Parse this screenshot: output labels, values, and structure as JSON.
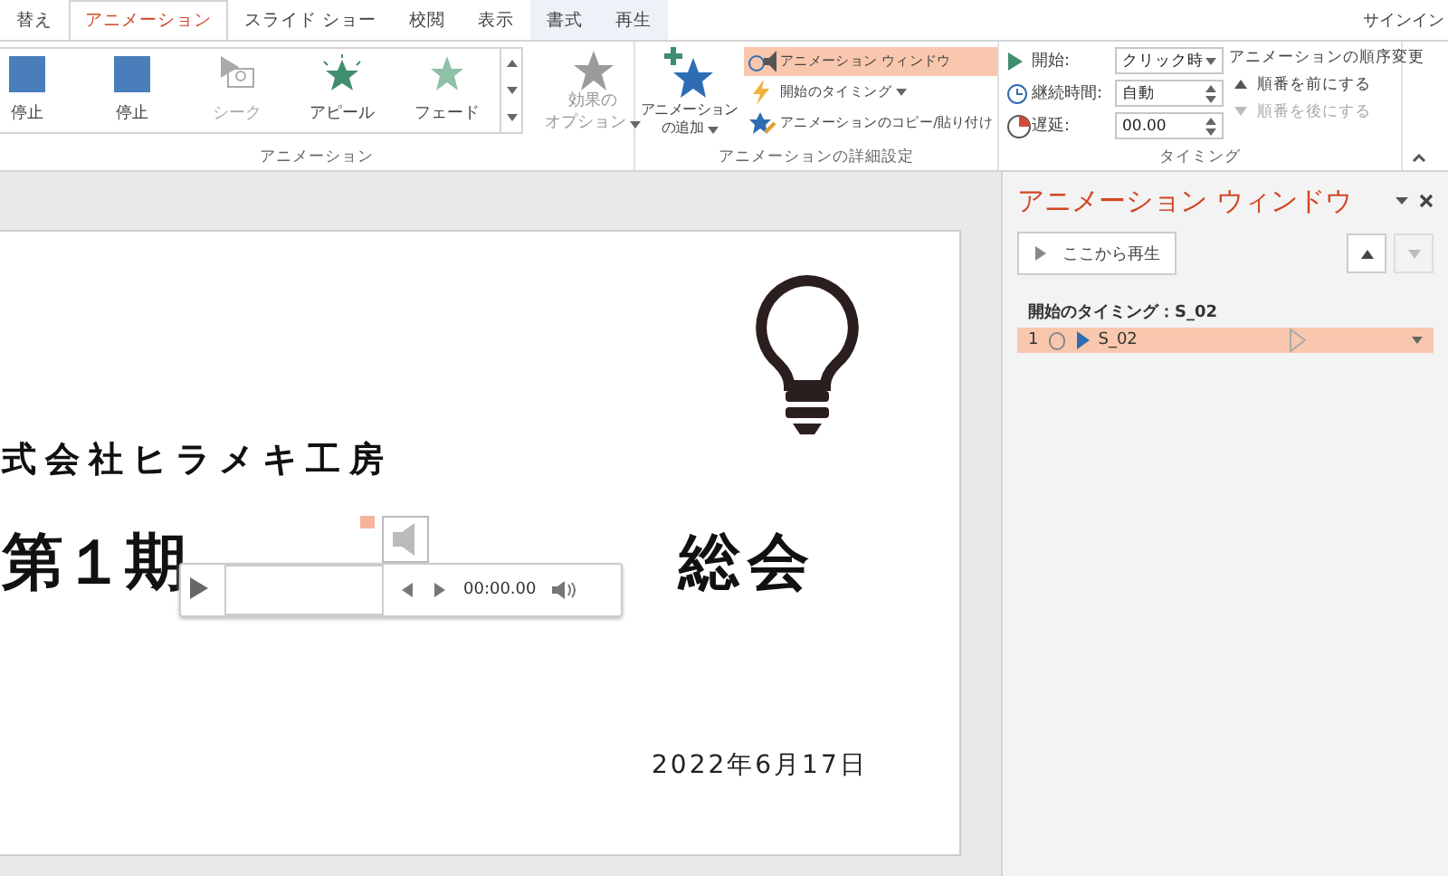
{
  "tabs": [
    {
      "label": "替え",
      "selected": false,
      "contextual": false
    },
    {
      "label": "アニメーション",
      "selected": true,
      "contextual": false
    },
    {
      "label": "スライド ショー",
      "selected": false,
      "contextual": false
    },
    {
      "label": "校閲",
      "selected": false,
      "contextual": false
    },
    {
      "label": "表示",
      "selected": false,
      "contextual": false
    },
    {
      "label": "書式",
      "selected": false,
      "contextual": true
    },
    {
      "label": "再生",
      "selected": false,
      "contextual": true
    }
  ],
  "signin": "サインイン",
  "animation_group": {
    "label": "アニメーション",
    "effects": [
      {
        "kind": "stop",
        "label": "停止",
        "disabled": false
      },
      {
        "kind": "stop",
        "label": "停止",
        "disabled": false
      },
      {
        "kind": "seek",
        "label": "シーク",
        "disabled": true
      },
      {
        "kind": "appeal",
        "label": "アピール",
        "disabled": false
      },
      {
        "kind": "fade",
        "label": "フェード",
        "disabled": false
      }
    ],
    "options": {
      "line1": "効果の",
      "line2": "オプション",
      "disabled": true
    }
  },
  "advanced_group": {
    "label": "アニメーションの詳細設定",
    "add": {
      "line1": "アニメーション",
      "line2": "の追加"
    },
    "items": [
      {
        "kind": "pane",
        "label": "アニメーション ウィンドウ",
        "selected": true
      },
      {
        "kind": "trigger",
        "label": "開始のタイミング",
        "selected": false
      },
      {
        "kind": "painter",
        "label": "アニメーションのコピー/貼り付け",
        "selected": false
      }
    ]
  },
  "timing_group": {
    "label": "タイミング",
    "start_label": "開始:",
    "start_value": "クリック時",
    "duration_label": "継続時間:",
    "duration_value": "自動",
    "delay_label": "遅延:",
    "delay_value": "00.00",
    "reorder_title": "アニメーションの順序変更",
    "reorder": [
      {
        "label": "順番を前にする",
        "disabled": false
      },
      {
        "label": "順番を後にする",
        "disabled": true
      }
    ]
  },
  "slide": {
    "company": "式会社ヒラメキ工房",
    "title_left": "第１期",
    "title_right": "総会",
    "date": "2022年6月17日",
    "player": {
      "time": "00:00.00"
    }
  },
  "pane": {
    "title": "アニメーション ウィンドウ",
    "play_button": "ここから再生",
    "up_disabled": false,
    "down_disabled": true,
    "group_label": "開始のタイミング：S_02",
    "items": [
      {
        "number": "1",
        "name": "S_02",
        "selected": true
      }
    ]
  }
}
